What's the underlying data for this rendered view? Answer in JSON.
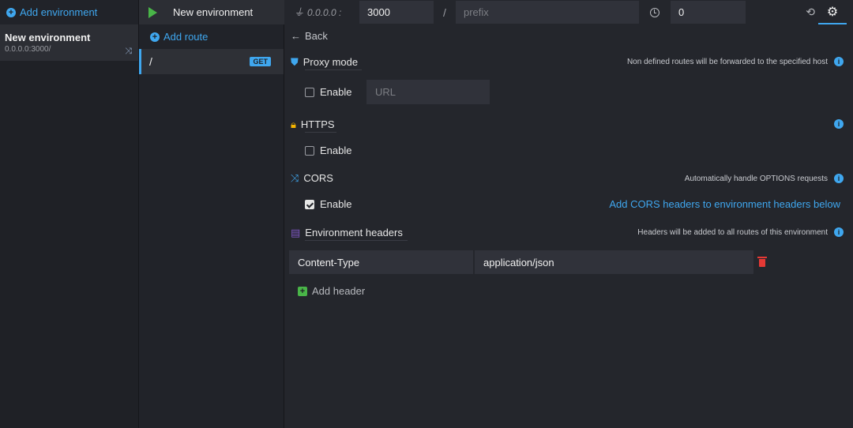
{
  "environments": {
    "add_label": "Add environment",
    "items": [
      {
        "name": "New environment",
        "address": "0.0.0.0:3000/"
      }
    ]
  },
  "runbar": {
    "env_name": "New environment"
  },
  "routes": {
    "add_label": "Add route",
    "items": [
      {
        "path": "/",
        "method": "GET"
      }
    ]
  },
  "topbar": {
    "host_label": "0.0.0.0 :",
    "port": "3000",
    "separator": "/",
    "prefix_placeholder": "prefix",
    "latency": "0"
  },
  "settings": {
    "back_label": "Back",
    "proxy": {
      "title": "Proxy mode",
      "hint": "Non defined routes will be forwarded to the specified host",
      "enable_label": "Enable",
      "enabled": false,
      "url_placeholder": "URL"
    },
    "https": {
      "title": "HTTPS",
      "enable_label": "Enable",
      "enabled": false
    },
    "cors": {
      "title": "CORS",
      "hint": "Automatically handle OPTIONS requests",
      "enable_label": "Enable",
      "enabled": true,
      "link_label": "Add CORS headers to environment headers below"
    },
    "headers": {
      "title": "Environment headers",
      "hint": "Headers will be added to all routes of this environment",
      "rows": [
        {
          "key": "Content-Type",
          "value": "application/json"
        }
      ],
      "add_label": "Add header"
    }
  },
  "colors": {
    "accent": "#3fa7ef",
    "success": "#49b548",
    "danger": "#e53935",
    "background": "#24262c"
  },
  "icons": [
    "plus-circle-icon",
    "shuffle-icon",
    "play-icon",
    "plug-icon",
    "clock-icon",
    "history-icon",
    "gear-icon",
    "arrow-left-icon",
    "shield-icon",
    "lock-icon",
    "cors-icon",
    "headers-icon",
    "info-icon",
    "trash-icon",
    "plus-square-icon"
  ]
}
